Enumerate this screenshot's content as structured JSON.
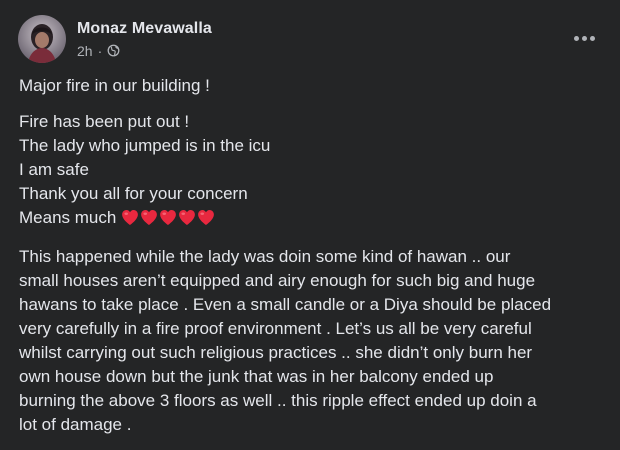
{
  "post": {
    "author": "Monaz Mevawalla",
    "timestamp": "2h",
    "separator": "·",
    "privacy_icon": "globe-icon",
    "more_icon": "more-horizontal-icon",
    "avatar_icon": "profile-avatar",
    "lines_1": [
      "Major fire in our building !"
    ],
    "lines_2": [
      "Fire has been put out !",
      "The lady who jumped is in the icu",
      "I am safe",
      "Thank you all for your concern",
      "Means much"
    ],
    "heart_emoji": "red-heart-icon",
    "heart_count": 5,
    "lines_3": [
      "This happened while the lady was doin some kind of hawan .. our",
      "small houses aren’t equipped and airy enough for such big and huge",
      "hawans to take place . Even a small candle or a Diya should be placed",
      "very carefully in a fire proof environment . Let’s us all be very careful",
      "whilst carrying out such religious practices .. she didn’t only burn her",
      "own house down but the junk that was in her balcony ended up",
      "burning the above 3 floors as well .. this ripple effect ended up doin a",
      "lot of damage ."
    ]
  },
  "colors": {
    "background": "#242526",
    "primary_text": "#e4e6eb",
    "secondary_text": "#b0b3b8",
    "heart": "#e8283f"
  }
}
